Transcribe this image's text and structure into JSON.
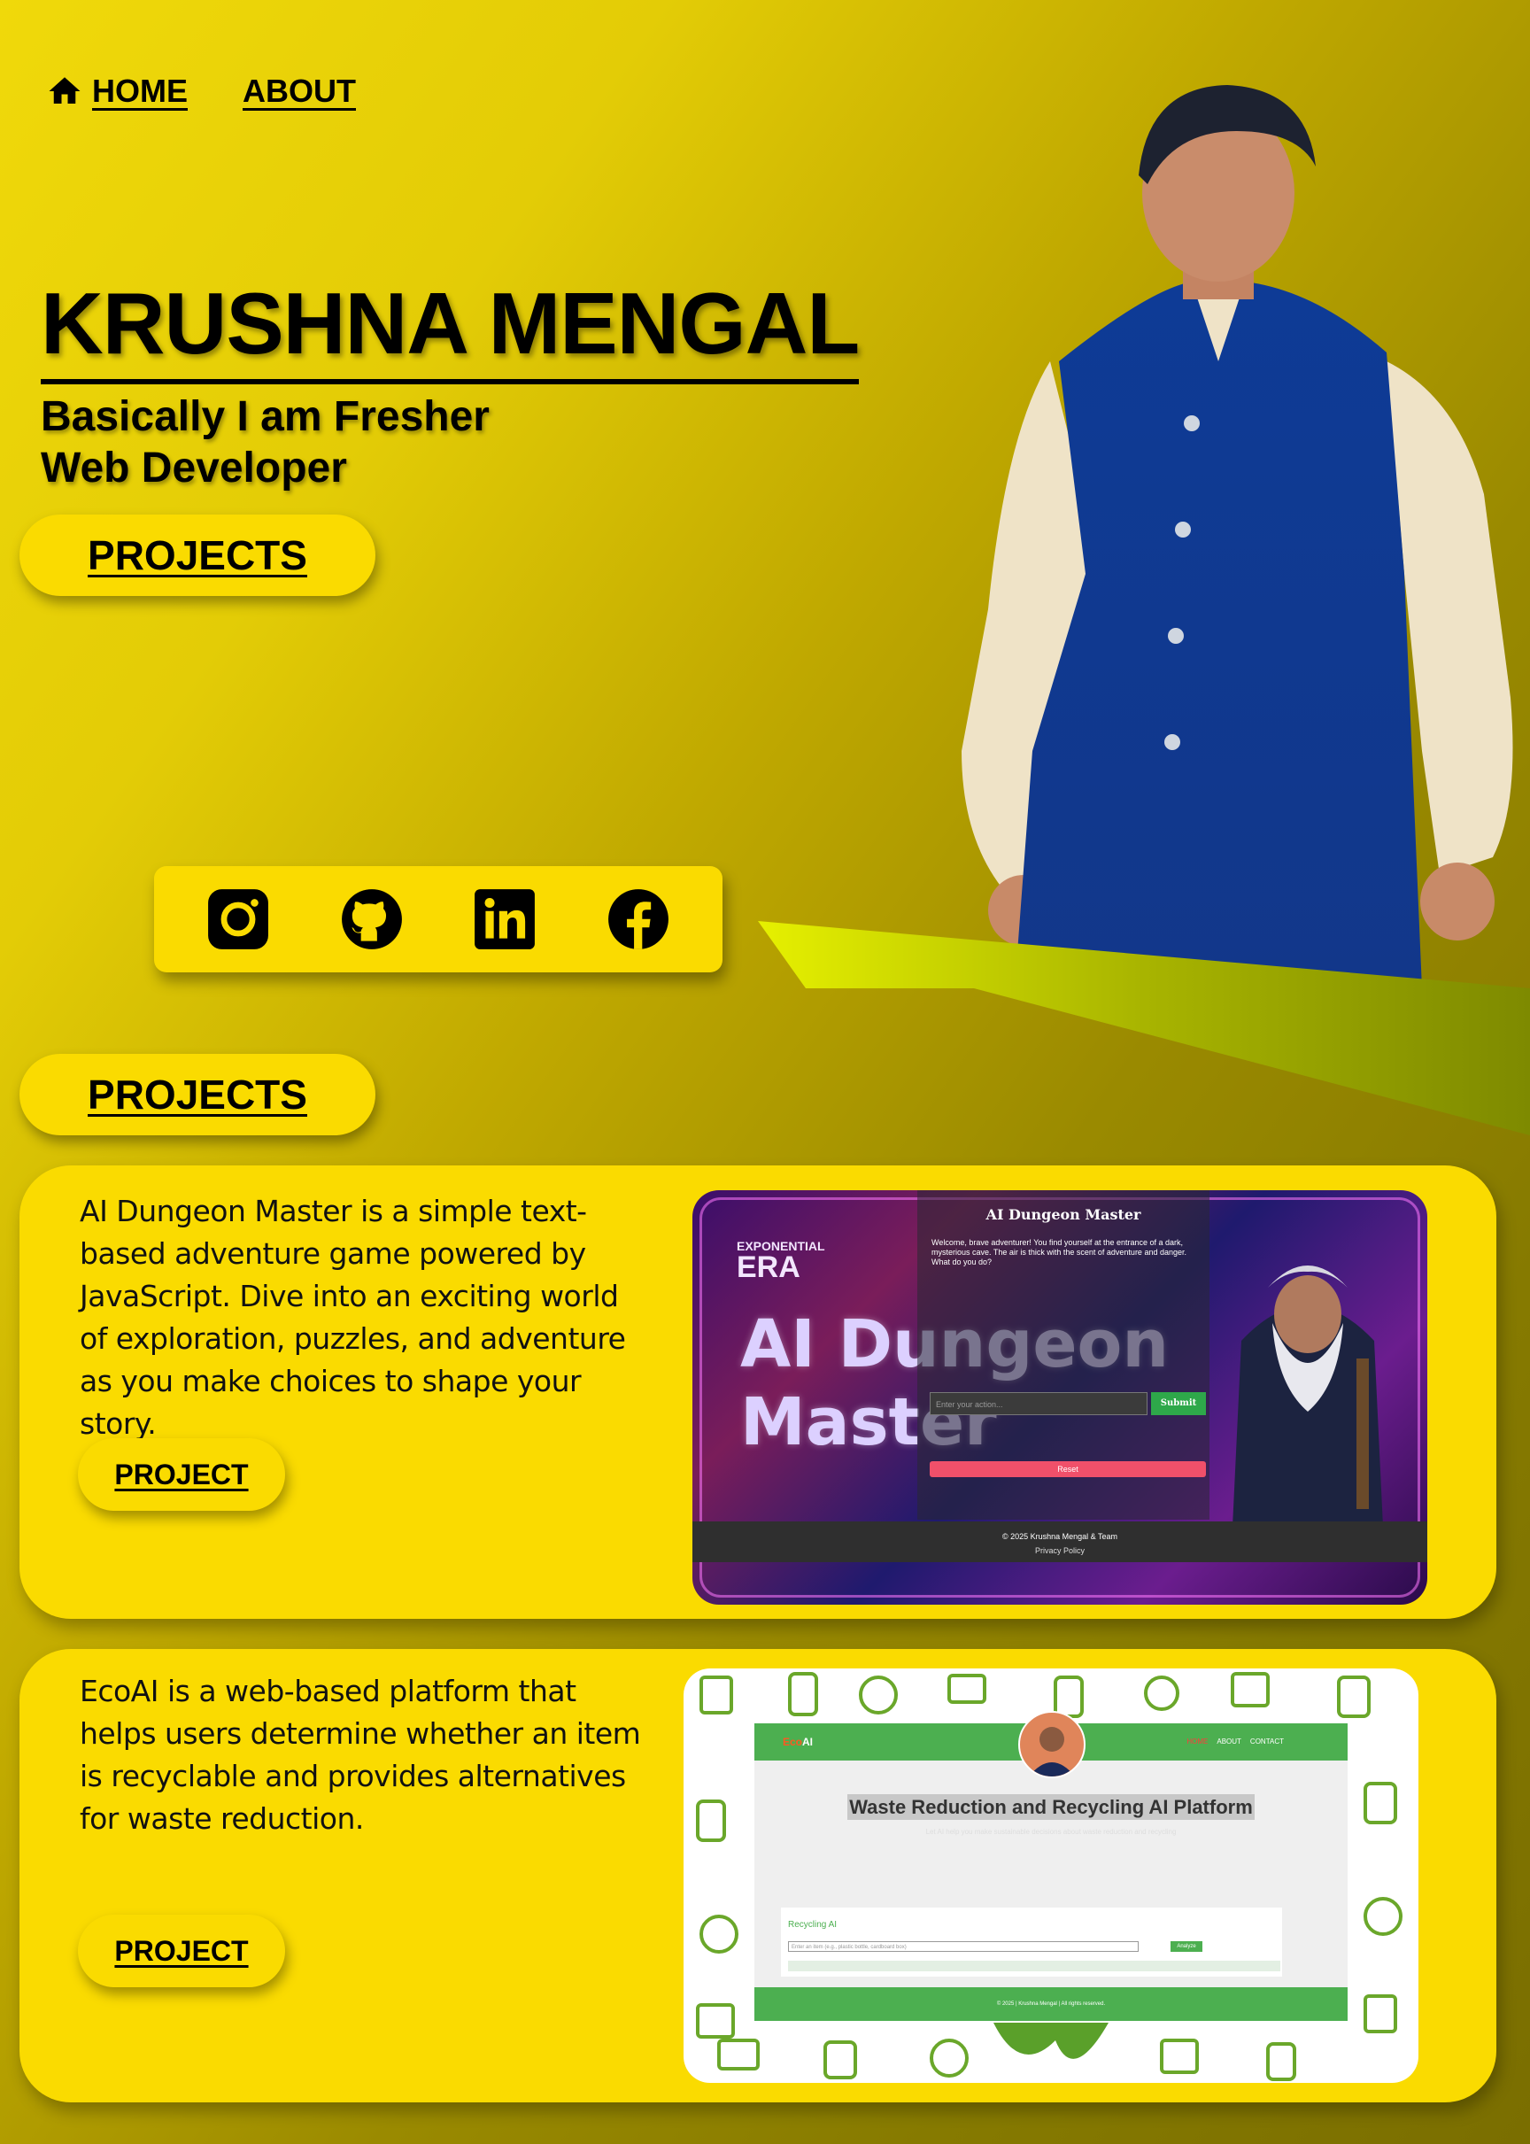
{
  "nav": {
    "home_label": "HOME",
    "about_label": "ABOUT",
    "home_icon": "home-icon"
  },
  "hero": {
    "name": "KRUSHNA MENGAL",
    "subtitle_line1": "Basically I am Fresher",
    "subtitle_line2": "Web Developer",
    "projects_button": "PROJECTS"
  },
  "social": {
    "icons": [
      "instagram-icon",
      "github-icon",
      "linkedin-icon",
      "facebook-icon"
    ]
  },
  "projects_section": {
    "title": "PROJECTS"
  },
  "projects": [
    {
      "description": "AI Dungeon Master is a simple text-based adventure game powered by JavaScript. Dive into an exciting world of exploration, puzzles, and adventure as you make choices to shape your story.",
      "button": "PROJECT",
      "screenshot": {
        "era_line1": "EXPONENTIAL",
        "era_line2": "ERA",
        "big_title_line1": "AI Dungeon",
        "big_title_line2": "Master",
        "panel_title": "AI Dungeon Master",
        "panel_text": "Welcome, brave adventurer! You find yourself at the entrance of a dark, mysterious cave. The air is thick with the scent of adventure and danger. What do you do?",
        "input_placeholder": "Enter your action...",
        "submit_label": "Submit",
        "reset_label": "Reset",
        "footer_line1": "© 2025 Krushna Mengal & Team",
        "footer_line2": "Privacy Policy"
      }
    },
    {
      "description": "EcoAI is a web-based platform that helps users determine whether an item is recyclable and provides alternatives for waste reduction.",
      "button": "PROJECT",
      "screenshot": {
        "logo_eco": "Eco",
        "logo_ai": "AI",
        "nav_home": "HOME",
        "nav_about": "ABOUT",
        "nav_contact": "CONTACT",
        "heading": "Waste Reduction and Recycling AI Platform",
        "faint_text": "Let AI help you make sustainable decisions about waste reduction and recycling",
        "box_title": "Recycling AI",
        "input_placeholder": "Enter an item (e.g., plastic bottle, cardboard box)",
        "analyze_label": "Analyze",
        "footer": "© 2025 | Krushna Mengal | All rights reserved."
      }
    }
  ],
  "colors": {
    "accent_yellow": "#fadb00",
    "background_gradient_start": "#f0d90a",
    "background_gradient_end": "#7a6e00",
    "eco_green": "#4caf50"
  }
}
